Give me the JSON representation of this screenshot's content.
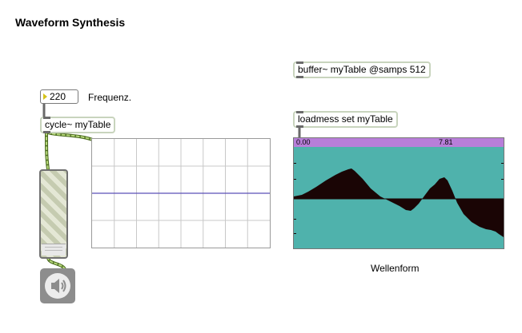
{
  "title": "Waveform Synthesis",
  "number_box": {
    "value": "220",
    "label": "Frequenz."
  },
  "objects": {
    "cycle": "cycle~ myTable",
    "buffer": "buffer~ myTable @samps 512",
    "loadmess": "loadmess set myTable"
  },
  "waveform": {
    "ruler_start": "0.00",
    "ruler_end": "7.81",
    "caption": "Wellenform",
    "colors": {
      "background": "#4fb2ac",
      "wave": "#1a0505",
      "ruler": "#b87ed9"
    }
  },
  "icons": {
    "dac": "speaker-icon",
    "gain": "gain-slider"
  },
  "patch_cord_color": "#9bc552"
}
